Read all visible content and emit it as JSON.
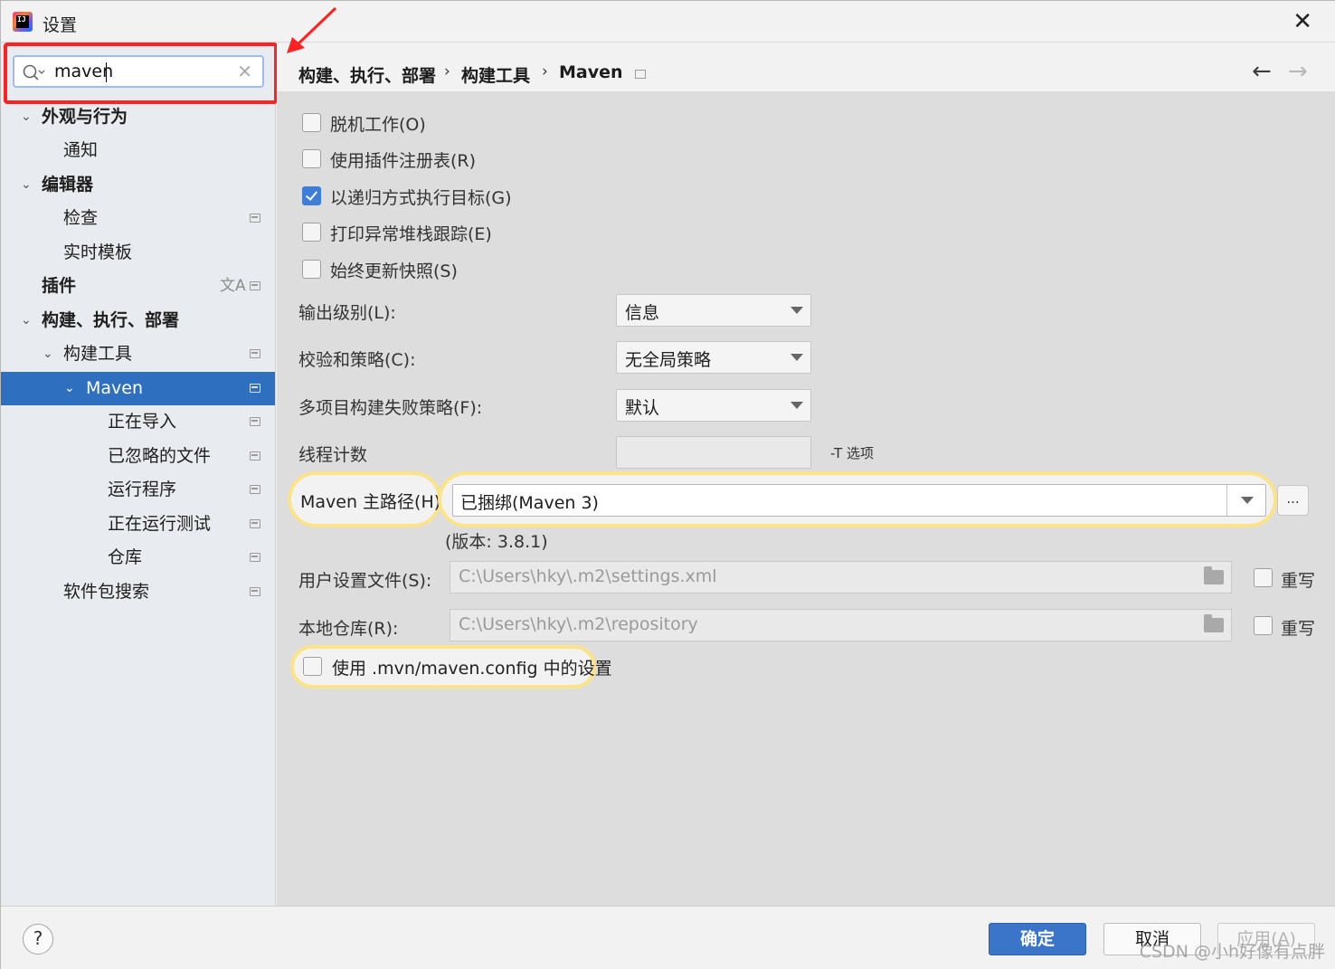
{
  "window": {
    "title": "设置"
  },
  "search": {
    "value": "maven"
  },
  "sidebar": {
    "items": [
      {
        "label": "外观与行为",
        "bold": true
      },
      {
        "label": "通知"
      },
      {
        "label": "编辑器",
        "bold": true
      },
      {
        "label": "检查"
      },
      {
        "label": "实时模板"
      },
      {
        "label": "插件",
        "bold": true
      },
      {
        "label": "构建、执行、部署",
        "bold": true
      },
      {
        "label": "构建工具"
      },
      {
        "label": "Maven",
        "selected": true
      },
      {
        "label": "正在导入"
      },
      {
        "label": "已忽略的文件"
      },
      {
        "label": "运行程序"
      },
      {
        "label": "正在运行测试"
      },
      {
        "label": "仓库"
      },
      {
        "label": "软件包搜索"
      }
    ]
  },
  "breadcrumb": {
    "items": [
      "构建、执行、部署",
      "构建工具",
      "Maven"
    ],
    "separator": "›"
  },
  "options": {
    "offline": {
      "label": "脱机工作(O)",
      "checked": false
    },
    "plugin_registry": {
      "label": "使用插件注册表(R)",
      "checked": false
    },
    "recursive": {
      "label": "以递归方式执行目标(G)",
      "checked": true
    },
    "print_stack": {
      "label": "打印异常堆栈跟踪(E)",
      "checked": false
    },
    "always_update": {
      "label": "始终更新快照(S)",
      "checked": false
    }
  },
  "form": {
    "output_level": {
      "label": "输出级别(L):",
      "value": "信息"
    },
    "checksum": {
      "label": "校验和策略(C):",
      "value": "无全局策略"
    },
    "multiproject": {
      "label": "多项目构建失败策略(F):",
      "value": "默认"
    },
    "threads": {
      "label": "线程计数",
      "value": "",
      "hint": "-T 选项"
    },
    "maven_home": {
      "label": "Maven 主路径(H):",
      "value": "已捆绑(Maven 3)",
      "browse": "...",
      "version": "(版本: 3.8.1)"
    },
    "user_settings": {
      "label": "用户设置文件(S):",
      "value": "C:\\Users\\hky\\.m2\\settings.xml",
      "override": "重写"
    },
    "local_repo": {
      "label": "本地仓库(R):",
      "value": "C:\\Users\\hky\\.m2\\repository",
      "override": "重写"
    },
    "mvn_config": {
      "label": "使用 .mvn/maven.config 中的设置",
      "checked": false
    }
  },
  "footer": {
    "help": "?",
    "ok": "确定",
    "cancel": "取消",
    "apply": "应用(A)"
  },
  "watermark": "CSDN @小h好像有点胖",
  "colors": {
    "selection": "#2f6fc0",
    "highlight_ring": "#fbe38a",
    "annotation": "#ff2222",
    "primary_button": "#3a75c9"
  }
}
